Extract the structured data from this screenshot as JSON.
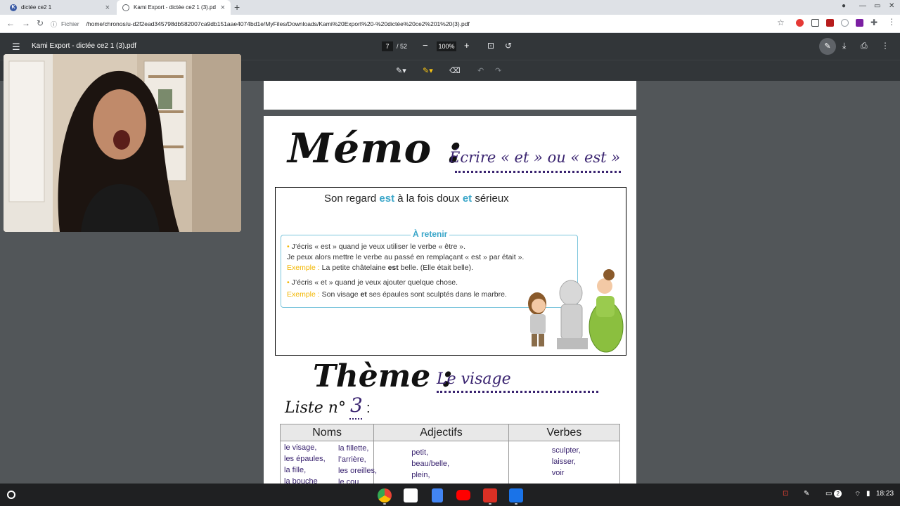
{
  "browser": {
    "tabs": [
      {
        "title": "dictée ce2 1",
        "favicon": "K",
        "favicon_color": "#3b5ba5",
        "active": false
      },
      {
        "title": "Kami Export - dictée ce2 1 (3).pd",
        "favicon": "globe",
        "active": true
      }
    ],
    "omnibox": {
      "scheme_label": "Fichier",
      "url": "/home/chronos/u-d2f2ead345798db582007ca9db151aae4074bd1e/MyFiles/Downloads/Kami%20Export%20-%20dictée%20ce2%201%20(3).pdf"
    }
  },
  "pdf_viewer": {
    "title": "Kami Export - dictée ce2 1 (3).pdf",
    "page_current": "7",
    "page_total": "/ 52",
    "zoom": "100%"
  },
  "document": {
    "memo_title": "Mémo :",
    "memo_subtitle": "Écrire « et » ou « est »",
    "example_parts": [
      "Son regard ",
      "est",
      " à la fois doux ",
      "et",
      " sérieux"
    ],
    "retenir_title": "À retenir",
    "rule1_line1": "J’écris « est » quand je veux utiliser le verbe « être ».",
    "rule1_line2": "Je peux alors mettre le verbe au passé en remplaçant « est » par était ».",
    "rule1_example_label": "Exemple :",
    "rule1_example_pre": " La petite châtelaine ",
    "rule1_example_bold": "est",
    "rule1_example_post": " belle. (Elle était belle).",
    "rule2_line1": "J’écris « et » quand je veux ajouter quelque chose.",
    "rule2_example_label": "Exemple :",
    "rule2_example_pre": " Son visage ",
    "rule2_example_bold": "et",
    "rule2_example_post": " ses épaules sont sculptés dans le marbre.",
    "theme_title": "Thème :",
    "theme_subtitle": "Le visage",
    "liste_label": "Liste n°",
    "liste_number": "3",
    "table": {
      "headers": [
        "Noms",
        "Adjectifs",
        "Verbes"
      ],
      "noms_col1": [
        "le visage,",
        "les épaules,",
        "la fille,",
        "la bouche"
      ],
      "noms_col2": [
        "la fillette,",
        "l’arrière,",
        "les oreilles,",
        "le cou"
      ],
      "adjectifs": [
        "petit,",
        "beau/belle,",
        "plein,"
      ],
      "verbes": [
        "sculpter,",
        "laisser,",
        "voir"
      ]
    }
  },
  "shelf": {
    "time": "18:23",
    "notification_count": "2"
  },
  "colors": {
    "accent_blue": "#3aa6c9",
    "handwriting_purple": "#3a2470",
    "example_yellow": "#f2b600"
  }
}
